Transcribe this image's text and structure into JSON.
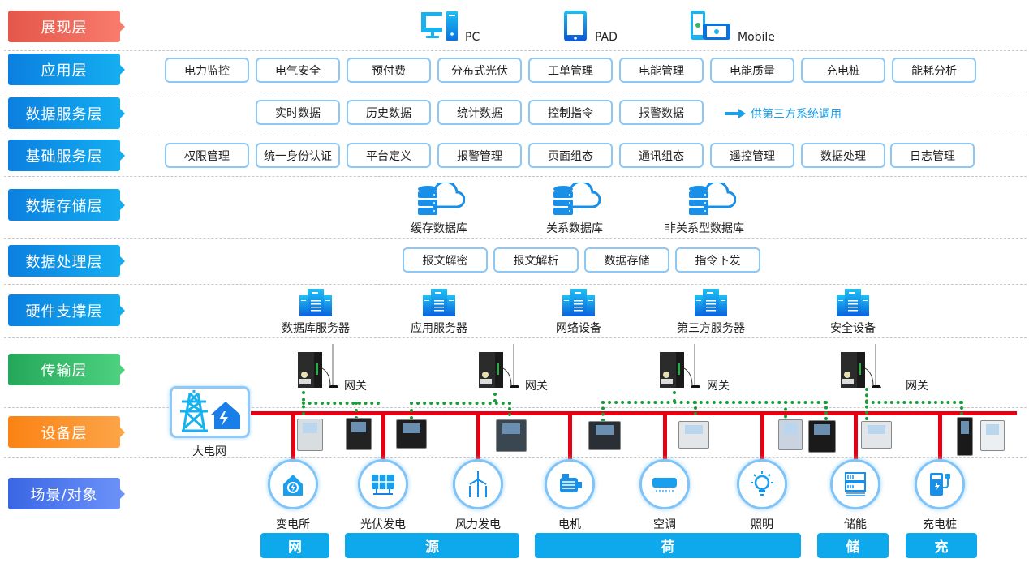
{
  "layers": [
    {
      "label": "展现层",
      "color": "red"
    },
    {
      "label": "应用层",
      "color": "blue"
    },
    {
      "label": "数据服务层",
      "color": "blue"
    },
    {
      "label": "基础服务层",
      "color": "blue"
    },
    {
      "label": "数据存储层",
      "color": "blue"
    },
    {
      "label": "数据处理层",
      "color": "blue"
    },
    {
      "label": "硬件支撑层",
      "color": "blue"
    },
    {
      "label": "传输层",
      "color": "green"
    },
    {
      "label": "设备层",
      "color": "orange"
    },
    {
      "label": "场景/对象",
      "color": "indigo"
    }
  ],
  "presentation": {
    "clients": [
      {
        "label": "PC",
        "icon": "pc-icon"
      },
      {
        "label": "PAD",
        "icon": "tablet-icon"
      },
      {
        "label": "Mobile",
        "icon": "mobile-icon"
      }
    ]
  },
  "application": {
    "items": [
      "电力监控",
      "电气安全",
      "预付费",
      "分布式光伏",
      "工单管理",
      "电能管理",
      "电能质量",
      "充电桩",
      "能耗分析"
    ]
  },
  "data_service": {
    "items": [
      "实时数据",
      "历史数据",
      "统计数据",
      "控制指令",
      "报警数据"
    ],
    "note": "供第三方系统调用"
  },
  "base_service": {
    "items": [
      "权限管理",
      "统一身份认证",
      "平台定义",
      "报警管理",
      "页面组态",
      "通讯组态",
      "遥控管理",
      "数据处理",
      "日志管理"
    ]
  },
  "storage": {
    "items": [
      "缓存数据库",
      "关系数据库",
      "非关系型数据库"
    ]
  },
  "processing": {
    "items": [
      "报文解密",
      "报文解析",
      "数据存储",
      "指令下发"
    ]
  },
  "hardware": {
    "items": [
      "数据库服务器",
      "应用服务器",
      "网络设备",
      "第三方服务器",
      "安全设备"
    ]
  },
  "transport": {
    "gateways": [
      "网关",
      "网关",
      "网关",
      "网关"
    ]
  },
  "device_layer": {
    "grid_label": "大电网"
  },
  "scenes": {
    "items": [
      {
        "label": "变电所",
        "icon": "substation-icon"
      },
      {
        "label": "光伏发电",
        "icon": "solar-panel-icon"
      },
      {
        "label": "风力发电",
        "icon": "wind-turbine-icon"
      },
      {
        "label": "电机",
        "icon": "motor-icon"
      },
      {
        "label": "空调",
        "icon": "air-conditioner-icon"
      },
      {
        "label": "照明",
        "icon": "light-bulb-icon"
      },
      {
        "label": "储能",
        "icon": "energy-storage-icon"
      },
      {
        "label": "充电桩",
        "icon": "charging-pile-icon"
      }
    ],
    "categories": [
      "网",
      "源",
      "荷",
      "储",
      "充"
    ]
  },
  "colors": {
    "accent": "#0ea9ec",
    "bus": "#e60012",
    "link": "#1a9a3a",
    "box_border": "#8cc8f5"
  }
}
